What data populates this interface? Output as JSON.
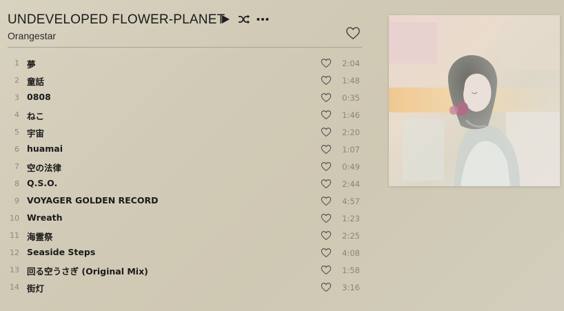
{
  "album": {
    "title": "UNDEVELOPED FLOWER-PLANET",
    "artist": "Orangestar",
    "actions": {
      "play_icon": "play-icon",
      "shuffle_icon": "shuffle-icon",
      "more_icon": "more-icon",
      "favorite_icon": "heart-icon"
    }
  },
  "tracks": [
    {
      "num": "1",
      "title": "夢",
      "duration": "2:04"
    },
    {
      "num": "2",
      "title": "童話",
      "duration": "1:48"
    },
    {
      "num": "3",
      "title": "0808",
      "duration": "0:35"
    },
    {
      "num": "4",
      "title": "ねこ",
      "duration": "1:46"
    },
    {
      "num": "5",
      "title": "宇宙",
      "duration": "2:20"
    },
    {
      "num": "6",
      "title": "huamai",
      "duration": "1:07"
    },
    {
      "num": "7",
      "title": "空の法律",
      "duration": "0:49"
    },
    {
      "num": "8",
      "title": "Q.S.O.",
      "duration": "2:44"
    },
    {
      "num": "9",
      "title": "VOYAGER GOLDEN RECORD",
      "duration": "4:57"
    },
    {
      "num": "10",
      "title": "Wreath",
      "duration": "1:23"
    },
    {
      "num": "11",
      "title": "海霊祭",
      "duration": "2:25"
    },
    {
      "num": "12",
      "title": "Seaside Steps",
      "duration": "4:08"
    },
    {
      "num": "13",
      "title": "回る空うさぎ (Original Mix)",
      "duration": "1:58"
    },
    {
      "num": "14",
      "title": "街灯",
      "duration": "3:16"
    }
  ],
  "colors": {
    "background": "#d1cab6",
    "divider": "#a8a292",
    "icon": "#3b3b3b",
    "muted_text": "#8a8578"
  }
}
